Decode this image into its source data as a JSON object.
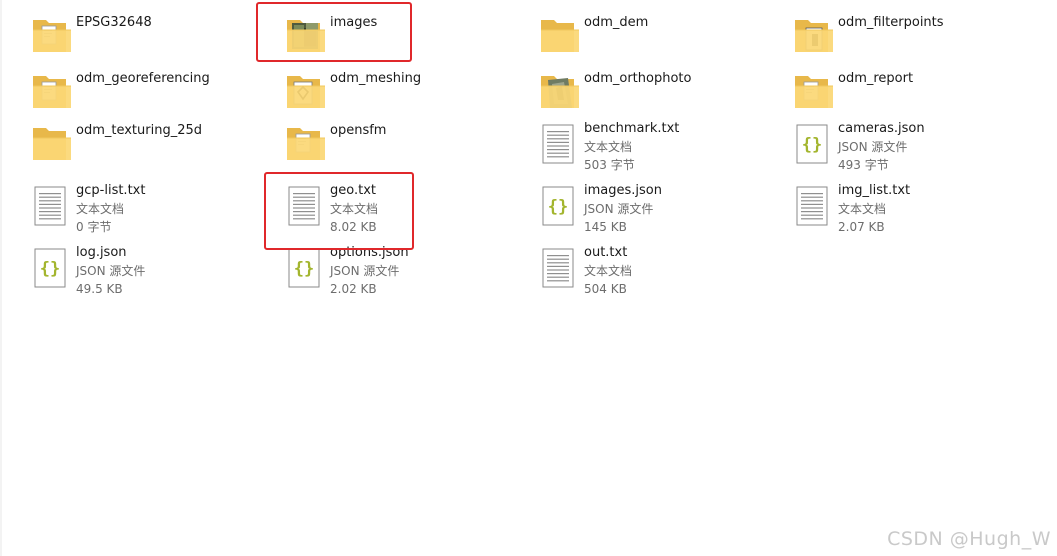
{
  "items": [
    {
      "name": "EPSG32648",
      "kind": "folder",
      "detail": "doc"
    },
    {
      "name": "images",
      "kind": "folder",
      "detail": "photo"
    },
    {
      "name": "odm_dem",
      "kind": "folder",
      "detail": "plain"
    },
    {
      "name": "odm_filterpoints",
      "kind": "folder",
      "detail": "dark"
    },
    {
      "name": "odm_georeferencing",
      "kind": "folder",
      "detail": "doc"
    },
    {
      "name": "odm_meshing",
      "kind": "folder",
      "detail": "mesh"
    },
    {
      "name": "odm_orthophoto",
      "kind": "folder",
      "detail": "ortho"
    },
    {
      "name": "odm_report",
      "kind": "folder",
      "detail": "doc"
    },
    {
      "name": "odm_texturing_25d",
      "kind": "folder",
      "detail": "plain"
    },
    {
      "name": "opensfm",
      "kind": "folder",
      "detail": "doc"
    },
    {
      "name": "benchmark.txt",
      "kind": "txt",
      "type": "文本文档",
      "size": "503 字节"
    },
    {
      "name": "cameras.json",
      "kind": "json",
      "type": "JSON 源文件",
      "size": "493 字节"
    },
    {
      "name": "gcp-list.txt",
      "kind": "txt",
      "type": "文本文档",
      "size": "0 字节"
    },
    {
      "name": "geo.txt",
      "kind": "txt",
      "type": "文本文档",
      "size": "8.02 KB"
    },
    {
      "name": "images.json",
      "kind": "json",
      "type": "JSON 源文件",
      "size": "145 KB"
    },
    {
      "name": "img_list.txt",
      "kind": "txt",
      "type": "文本文档",
      "size": "2.07 KB"
    },
    {
      "name": "log.json",
      "kind": "json",
      "type": "JSON 源文件",
      "size": "49.5 KB"
    },
    {
      "name": "options.json",
      "kind": "json",
      "type": "JSON 源文件",
      "size": "2.02 KB"
    },
    {
      "name": "out.txt",
      "kind": "txt",
      "type": "文本文档",
      "size": "504 KB"
    }
  ],
  "highlighted": [
    "images",
    "geo.txt"
  ],
  "colors": {
    "folder_back": "#e8b84a",
    "folder_front": "#fbd775",
    "highlight": "#e0282b",
    "json_brace": "#a3b52e"
  },
  "watermark": "CSDN @Hugh_W"
}
